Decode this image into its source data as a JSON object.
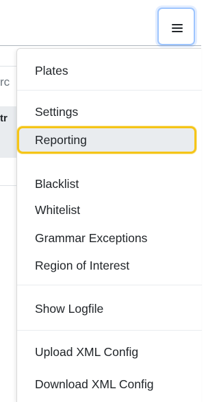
{
  "navbar": {
    "toggler_icon": "hamburger-menu-icon"
  },
  "background": {
    "fragment_text_1": "rc",
    "fragment_text_2": "tr"
  },
  "menu": {
    "items": [
      {
        "label": "Plates"
      },
      {
        "label": "Settings"
      },
      {
        "label": "Reporting",
        "highlighted": true
      },
      {
        "label": "Blacklist"
      },
      {
        "label": "Whitelist"
      },
      {
        "label": "Grammar Exceptions"
      },
      {
        "label": "Region of Interest"
      },
      {
        "label": "Show Logfile"
      },
      {
        "label": "Upload XML Config"
      },
      {
        "label": "Download XML Config"
      }
    ],
    "highlight_color": "#f5c518",
    "active_background": "#e9ecef"
  }
}
